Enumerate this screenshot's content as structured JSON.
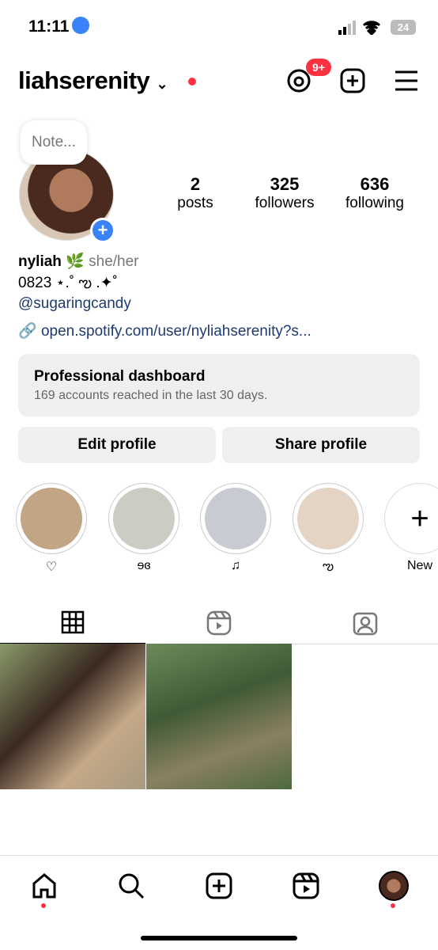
{
  "status": {
    "time": "11:11",
    "battery": "24"
  },
  "header": {
    "username": "liahserenity",
    "threads_badge": "9+"
  },
  "note": {
    "placeholder": "Note..."
  },
  "stats": [
    {
      "n": "2",
      "l": "posts"
    },
    {
      "n": "325",
      "l": "followers"
    },
    {
      "n": "636",
      "l": "following"
    }
  ],
  "bio": {
    "name": "nyliah",
    "emoji": "🌿",
    "pronouns": "she/her",
    "line": "0823 ⋆.˚ ఌ .✦˚",
    "mention": "@sugaringcandy",
    "link": "open.spotify.com/user/nyliahserenity?s..."
  },
  "dashboard": {
    "title": "Professional dashboard",
    "subtitle": "169 accounts reached in the last 30 days."
  },
  "buttons": {
    "edit": "Edit profile",
    "share": "Share profile"
  },
  "highlights": [
    {
      "label": "♡",
      "color": "#c2a585"
    },
    {
      "label": "ɘɞ",
      "color": "#cbccc3"
    },
    {
      "label": "♫",
      "color": "#c9cbd2"
    },
    {
      "label": "ఌ",
      "color": "#e4d4c6"
    }
  ],
  "new_highlight": {
    "label": "New"
  },
  "colors": {
    "accent": "#3a82f7",
    "notification": "#ff3040",
    "link": "#1e3a6e"
  }
}
